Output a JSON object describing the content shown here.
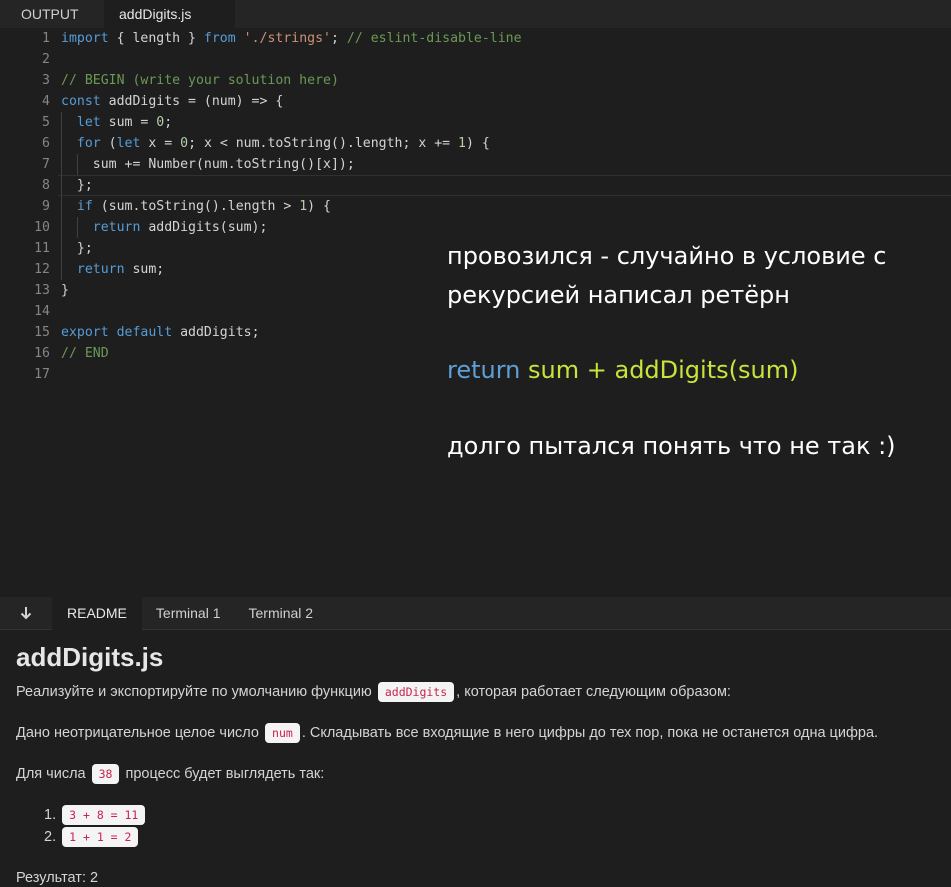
{
  "top_tabs": [
    {
      "label": "OUTPUT",
      "active": false
    },
    {
      "label": "addDigits.js",
      "active": true
    }
  ],
  "code_lines": [
    {
      "n": "1",
      "tokens": [
        {
          "t": "import",
          "c": "kw"
        },
        {
          "t": " { length } ",
          "c": "id"
        },
        {
          "t": "from",
          "c": "kw"
        },
        {
          "t": " ",
          "c": "id"
        },
        {
          "t": "'./strings'",
          "c": "str"
        },
        {
          "t": "; ",
          "c": "id"
        },
        {
          "t": "// eslint-disable-line",
          "c": "cmt"
        }
      ]
    },
    {
      "n": "2",
      "tokens": []
    },
    {
      "n": "3",
      "tokens": [
        {
          "t": "// BEGIN (write your solution here)",
          "c": "cmt"
        }
      ]
    },
    {
      "n": "4",
      "tokens": [
        {
          "t": "const",
          "c": "kw"
        },
        {
          "t": " addDigits = (num) => {",
          "c": "id"
        }
      ]
    },
    {
      "n": "5",
      "tokens": [
        {
          "t": "  ",
          "c": "id"
        },
        {
          "t": "let",
          "c": "kw"
        },
        {
          "t": " sum = ",
          "c": "id"
        },
        {
          "t": "0",
          "c": "num"
        },
        {
          "t": ";",
          "c": "id"
        }
      ]
    },
    {
      "n": "6",
      "tokens": [
        {
          "t": "  ",
          "c": "id"
        },
        {
          "t": "for",
          "c": "kw"
        },
        {
          "t": " (",
          "c": "id"
        },
        {
          "t": "let",
          "c": "kw"
        },
        {
          "t": " x = ",
          "c": "id"
        },
        {
          "t": "0",
          "c": "num"
        },
        {
          "t": "; x < num.toString().length; x += ",
          "c": "id"
        },
        {
          "t": "1",
          "c": "num"
        },
        {
          "t": ") {",
          "c": "id"
        }
      ]
    },
    {
      "n": "7",
      "tokens": [
        {
          "t": "    sum += Number(num.toString()[x]);",
          "c": "id"
        }
      ]
    },
    {
      "n": "8",
      "tokens": [
        {
          "t": "  };",
          "c": "id"
        }
      ]
    },
    {
      "n": "9",
      "tokens": [
        {
          "t": "  ",
          "c": "id"
        },
        {
          "t": "if",
          "c": "kw"
        },
        {
          "t": " (sum.toString().length > ",
          "c": "id"
        },
        {
          "t": "1",
          "c": "num"
        },
        {
          "t": ") {",
          "c": "id"
        }
      ]
    },
    {
      "n": "10",
      "tokens": [
        {
          "t": "    ",
          "c": "id"
        },
        {
          "t": "return",
          "c": "kw"
        },
        {
          "t": " addDigits(sum);",
          "c": "id"
        }
      ]
    },
    {
      "n": "11",
      "tokens": [
        {
          "t": "  };",
          "c": "id"
        }
      ]
    },
    {
      "n": "12",
      "tokens": [
        {
          "t": "  ",
          "c": "id"
        },
        {
          "t": "return",
          "c": "kw"
        },
        {
          "t": " sum;",
          "c": "id"
        }
      ]
    },
    {
      "n": "13",
      "tokens": [
        {
          "t": "}",
          "c": "id"
        }
      ]
    },
    {
      "n": "14",
      "tokens": []
    },
    {
      "n": "15",
      "tokens": [
        {
          "t": "export",
          "c": "kw"
        },
        {
          "t": " ",
          "c": "id"
        },
        {
          "t": "default",
          "c": "kw"
        },
        {
          "t": " addDigits;",
          "c": "id"
        }
      ]
    },
    {
      "n": "16",
      "tokens": [
        {
          "t": "// END",
          "c": "cmt"
        }
      ]
    },
    {
      "n": "17",
      "tokens": []
    }
  ],
  "note": {
    "line1": "провозился - случайно в условие с",
    "line2": "рекурсией написал ретёрн",
    "code_keyword": "return",
    "code_rest": " sum + addDigits(sum)",
    "line3": "долго пытался понять что не так :)"
  },
  "panel_tabs": [
    {
      "label": "README",
      "active": true
    },
    {
      "label": "Terminal 1",
      "active": false
    },
    {
      "label": "Terminal 2",
      "active": false
    }
  ],
  "readme": {
    "title": "addDigits.js",
    "p1_before": "Реализуйте и экспортируйте по умолчанию функцию",
    "p1_code": "addDigits",
    "p1_after": ", которая работает следующим образом:",
    "p2_before": "Дано неотрицательное целое число",
    "p2_code": "num",
    "p2_after": ". Складывать все входящие в него цифры до тех пор, пока не останется одна цифра.",
    "p3_before": "Для числа",
    "p3_code": "38",
    "p3_after": "процесс будет выглядеть так:",
    "steps": [
      {
        "num": "1.",
        "code": "3 + 8 = 11"
      },
      {
        "num": "2.",
        "code": "1 + 1 = 2"
      }
    ],
    "result": "Результат: 2"
  }
}
